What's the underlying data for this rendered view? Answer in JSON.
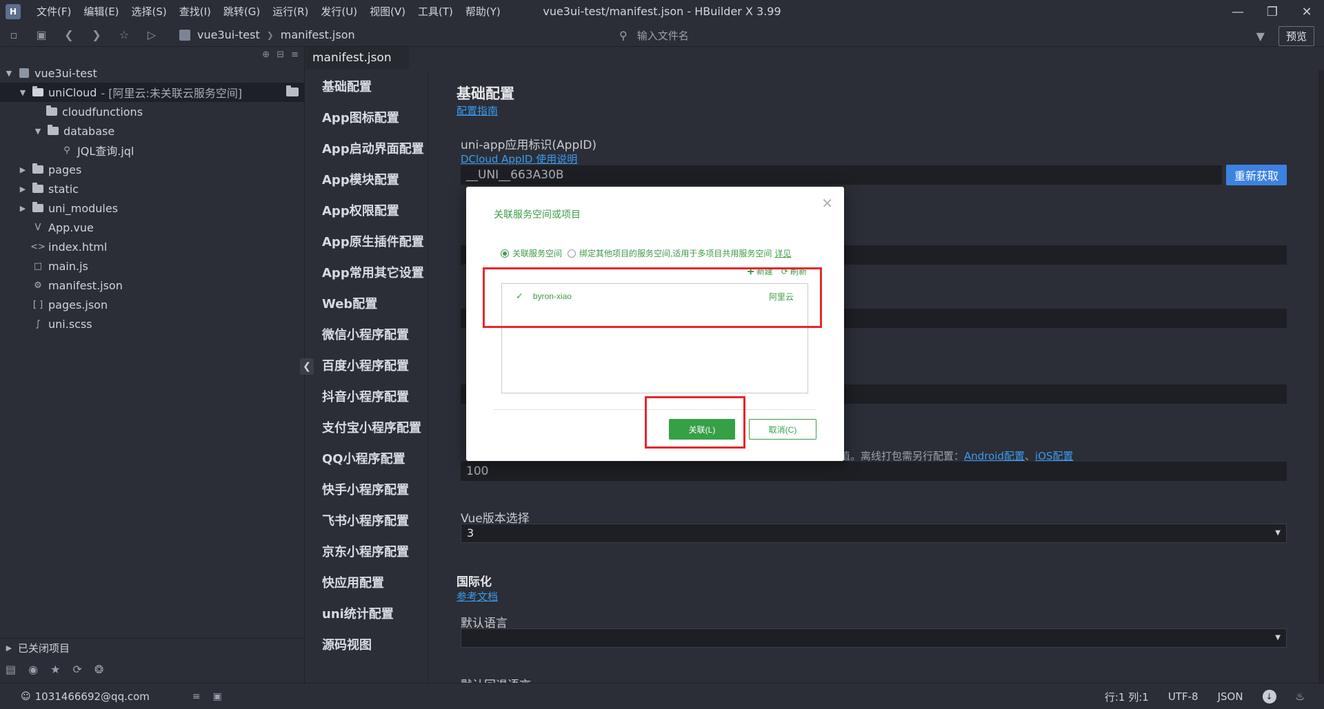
{
  "window": {
    "title": "vue3ui-test/manifest.json - HBuilder X 3.99",
    "logo": "H"
  },
  "menu": [
    "文件(F)",
    "编辑(E)",
    "选择(S)",
    "查找(I)",
    "跳转(G)",
    "运行(R)",
    "发行(U)",
    "视图(V)",
    "工具(T)",
    "帮助(Y)"
  ],
  "toolbar": {
    "breadcrumb": [
      "vue3ui-test",
      "manifest.json"
    ],
    "file_search_placeholder": "输入文件名",
    "preview_label": "预览"
  },
  "sidebar": {
    "project": "vue3ui-test",
    "tree": [
      {
        "label": "uniCloud",
        "suffix": "- [阿里云:未关联云服务空间]"
      },
      {
        "label": "cloudfunctions"
      },
      {
        "label": "database"
      },
      {
        "label": "JQL查询.jql"
      },
      {
        "label": "pages"
      },
      {
        "label": "static"
      },
      {
        "label": "uni_modules"
      },
      {
        "label": "App.vue"
      },
      {
        "label": "index.html"
      },
      {
        "label": "main.js"
      },
      {
        "label": "manifest.json"
      },
      {
        "label": "pages.json"
      },
      {
        "label": "uni.scss"
      }
    ],
    "closed_projects": "已关闭项目"
  },
  "editor_tab": "manifest.json",
  "config_nav": [
    "基础配置",
    "App图标配置",
    "App启动界面配置",
    "App模块配置",
    "App权限配置",
    "App原生插件配置",
    "App常用其它设置",
    "Web配置",
    "微信小程序配置",
    "百度小程序配置",
    "抖音小程序配置",
    "支付宝小程序配置",
    "QQ小程序配置",
    "快手小程序配置",
    "飞书小程序配置",
    "京东小程序配置",
    "快应用配置",
    "uni统计配置",
    "源码视图"
  ],
  "content": {
    "basic_title": "基础配置",
    "basic_link": "配置指南",
    "appid_label": "uni-app应用标识(AppID)",
    "appid_link": "DCloud AppID 使用说明",
    "appid_value": "__UNI__663A30B",
    "regain_label": "重新获取",
    "hint_tail": "值。离线打包需另行配置：",
    "android_link": "Android配置",
    "sep": "、",
    "ios_link": "iOS配置",
    "version_code": "100",
    "vue_label": "Vue版本选择",
    "vue_value": "3",
    "i18n_title": "国际化",
    "i18n_link": "参考文档",
    "default_lang_label": "默认语言",
    "fallback_lang_label": "默认回退语言"
  },
  "modal": {
    "title": "关联服务空间或项目",
    "radio_1": "关联服务空间",
    "radio_2": "绑定其他项目的服务空间,适用于多项目共用服务空间",
    "radio_link": "详见",
    "new_label": "新建",
    "refresh_label": "刷新",
    "space_name": "byron-xiao",
    "space_provider": "阿里云",
    "ok_label": "关联(L)",
    "cancel_label": "取消(C)"
  },
  "statusbar": {
    "user": "1031466692@qq.com",
    "position": "行:1  列:1",
    "encoding": "UTF-8",
    "language": "JSON"
  }
}
